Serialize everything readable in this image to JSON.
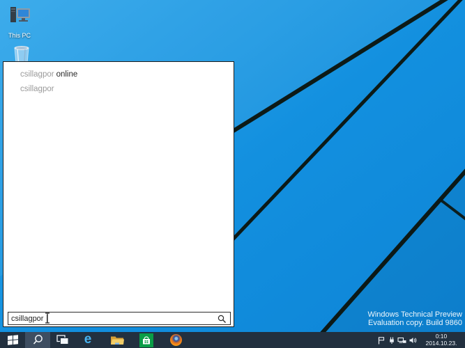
{
  "desktop": {
    "icons": {
      "this_pc": {
        "label": "This PC"
      }
    },
    "watermark": {
      "line1": "Windows Technical Preview",
      "line2": "Evaluation copy. Build 9860"
    }
  },
  "search_panel": {
    "suggestions": [
      {
        "typed": "csillagpor",
        "completion": "online"
      },
      {
        "typed": "csillagpor",
        "completion": ""
      }
    ],
    "input": {
      "value": "csillagpor",
      "icon": "magnifier"
    }
  },
  "taskbar": {
    "buttons": [
      {
        "id": "start",
        "icon": "windows-logo"
      },
      {
        "id": "search",
        "icon": "magnifier",
        "state": "active"
      },
      {
        "id": "task-view",
        "icon": "overlapping-windows"
      },
      {
        "id": "internet-explorer",
        "icon": "ie-e",
        "glyph": "e"
      },
      {
        "id": "file-explorer",
        "icon": "folder"
      },
      {
        "id": "store",
        "icon": "shopping-bag"
      },
      {
        "id": "firefox",
        "icon": "firefox-globe"
      }
    ],
    "tray": {
      "icons": [
        {
          "id": "action-center",
          "icon": "flag"
        },
        {
          "id": "hardware",
          "icon": "plug"
        },
        {
          "id": "network",
          "icon": "ethernet"
        },
        {
          "id": "volume",
          "icon": "speaker"
        }
      ],
      "clock": {
        "time": "0:10",
        "date": "2014.10.23."
      }
    }
  },
  "colors": {
    "desktop_blue": "#1390df",
    "wallpaper_line": "#0c140d",
    "taskbar": "#22303f",
    "taskbar_active": "#3e4e61",
    "suggestion_gray": "#9a9a9a",
    "suggestion_dark": "#282828"
  }
}
